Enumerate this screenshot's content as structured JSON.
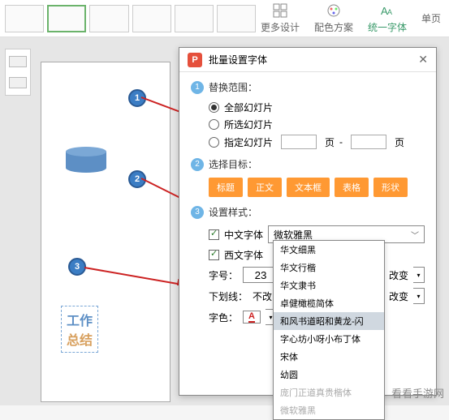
{
  "top_menu": {
    "more_design": "更多设计",
    "color_scheme": "配色方案",
    "unify_font": "统一字体",
    "single": "单页"
  },
  "slide": {
    "text_line1": "工作",
    "text_line2": "总结"
  },
  "badges": {
    "b1": "1",
    "b2": "2",
    "b3": "3"
  },
  "dialog": {
    "app_letter": "P",
    "title": "批量设置字体",
    "sec1": {
      "num": "1",
      "label": "替换范围：",
      "opt_all": "全部幻灯片",
      "opt_selected": "所选幻灯片",
      "opt_range": "指定幻灯片",
      "page_word1": "页",
      "page_sep": "-",
      "page_word2": "页"
    },
    "sec2": {
      "num": "2",
      "label": "选择目标：",
      "tags": [
        "标题",
        "正文",
        "文本框",
        "表格",
        "形状"
      ]
    },
    "sec3": {
      "num": "3",
      "label": "设置样式：",
      "cn_font_label": "中文字体",
      "cn_font_value": "微软雅黑",
      "en_font_label": "西文字体",
      "size_label": "字号：",
      "size_value": "23",
      "underline_label": "下划线：",
      "underline_value": "不改",
      "nochange": "改变",
      "color_label": "字色："
    },
    "dropdown": {
      "items": [
        "华文细黑",
        "华文行楷",
        "华文隶书",
        "卓健橄榄简体",
        "和风书道昭和黄龙-闪",
        "字心坊小呀小布丁体",
        "宋体",
        "幼圆",
        "庞门正道真贵楷体",
        "微软雅黑"
      ],
      "highlight_index": 4
    }
  },
  "watermark": "看看手游网"
}
